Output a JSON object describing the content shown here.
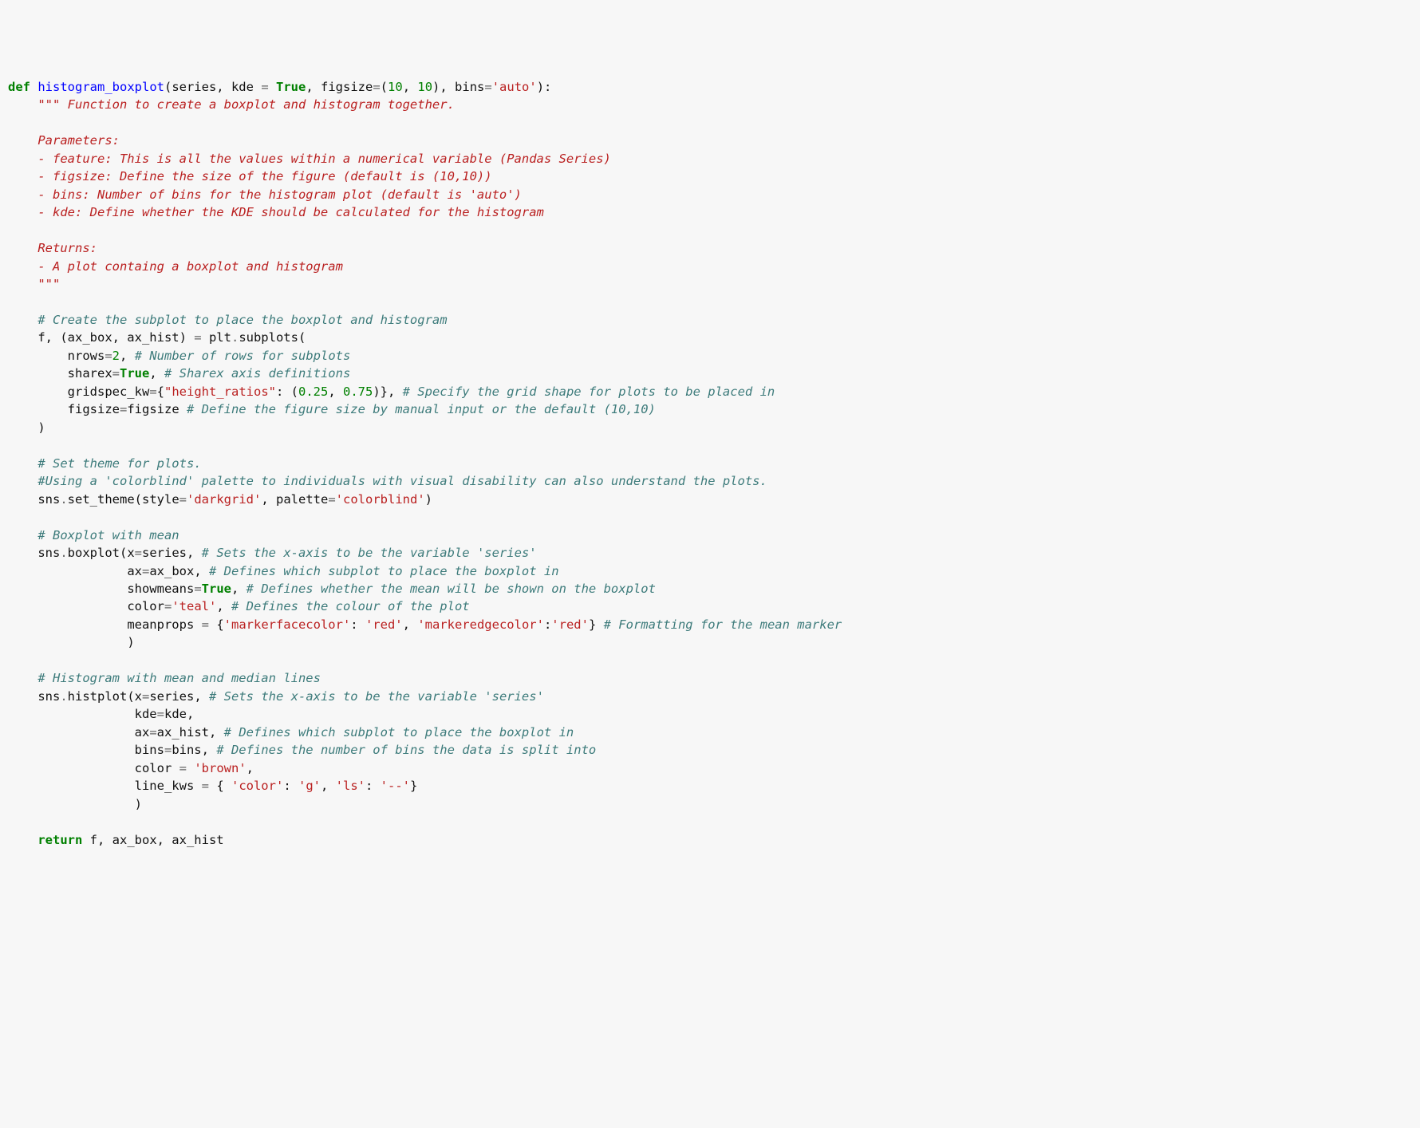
{
  "code": {
    "l1": {
      "kw1": "def",
      "fn": "histogram_boxplot",
      "s1": "(series, kde ",
      "eq1": "=",
      "sp1": " ",
      "true1": "True",
      "s2": ", figsize",
      "eq2": "=",
      "s3": "(",
      "n1": "10",
      "s4": ", ",
      "n2": "10",
      "s5": "), bins",
      "eq3": "=",
      "str1": "'auto'",
      "s6": "):"
    },
    "doc": "\"\"\" Function to create a boxplot and histogram together.\n\n    Parameters:\n    - feature: This is all the values within a numerical variable (Pandas Series)\n    - figsize: Define the size of the figure (default is (10,10))\n    - bins: Number of bins for the histogram plot (default is 'auto')\n    - kde: Define whether the KDE should be calculated for the histogram\n\n    Returns:\n    - A plot containg a boxplot and histogram\n    \"\"\"",
    "c_sub": "# Create the subplot to place the boxplot and histogram",
    "l_sub1": {
      "a": "f, (ax_box, ax_hist) ",
      "eq": "=",
      "b": " plt",
      "dot": ".",
      "c": "subplots("
    },
    "l_nrows": {
      "a": "nrows",
      "eq": "=",
      "n": "2",
      "b": ", ",
      "c": "# Number of rows for subplots"
    },
    "l_sharex": {
      "a": "sharex",
      "eq": "=",
      "b": "True",
      "c": ", ",
      "d": "# Sharex axis definitions"
    },
    "l_grid": {
      "a": "gridspec_kw",
      "eq": "=",
      "b": "{",
      "s1": "\"height_ratios\"",
      "c": ": (",
      "n1": "0.25",
      "d": ", ",
      "n2": "0.75",
      "e": ")}, ",
      "f": "# Specify the grid shape for plots to be placed in"
    },
    "l_fig": {
      "a": "figsize",
      "eq": "=",
      "b": "figsize ",
      "c": "# Define the figure size by manual input or the default (10,10)"
    },
    "close_paren": ")",
    "c_theme1": "# Set theme for plots.",
    "c_theme2": "#Using a 'colorblind' palette to individuals with visual disability can also understand the plots.",
    "l_theme": {
      "a": "sns",
      "dot": ".",
      "b": "set_theme(style",
      "eq1": "=",
      "s1": "'darkgrid'",
      "c": ", palette",
      "eq2": "=",
      "s2": "'colorblind'",
      "d": ")"
    },
    "c_box": "# Boxplot with mean",
    "l_box1": {
      "a": "sns",
      "dot": ".",
      "b": "boxplot(x",
      "eq": "=",
      "c": "series, ",
      "d": "# Sets the x-axis to be the variable 'series'"
    },
    "l_box2": {
      "a": "ax",
      "eq": "=",
      "b": "ax_box, ",
      "c": "# Defines which subplot to place the boxplot in"
    },
    "l_box3": {
      "a": "showmeans",
      "eq": "=",
      "b": "True",
      "c": ", ",
      "d": "# Defines whether the mean will be shown on the boxplot"
    },
    "l_box4": {
      "a": "color",
      "eq": "=",
      "s": "'teal'",
      "b": ", ",
      "c": "# Defines the colour of the plot"
    },
    "l_box5": {
      "a": "meanprops ",
      "eq": "=",
      "b": " {",
      "s1": "'markerfacecolor'",
      "c": ": ",
      "s2": "'red'",
      "d": ", ",
      "s3": "'markeredgecolor'",
      "e": ":",
      "s4": "'red'",
      "f": "} ",
      "g": "# Formatting for the mean marker"
    },
    "l_box6": ")",
    "c_hist": "# Histogram with mean and median lines",
    "l_hist1": {
      "a": "sns",
      "dot": ".",
      "b": "histplot(x",
      "eq": "=",
      "c": "series, ",
      "d": "# Sets the x-axis to be the variable 'series'"
    },
    "l_hist2": {
      "a": "kde",
      "eq": "=",
      "b": "kde,"
    },
    "l_hist3": {
      "a": "ax",
      "eq": "=",
      "b": "ax_hist, ",
      "c": "# Defines which subplot to place the boxplot in"
    },
    "l_hist4": {
      "a": "bins",
      "eq": "=",
      "b": "bins, ",
      "c": "# Defines the number of bins the data is split into"
    },
    "l_hist5": {
      "a": "color ",
      "eq": "=",
      "b": " ",
      "s": "'brown'",
      "c": ","
    },
    "l_hist6": {
      "a": "line_kws ",
      "eq": "=",
      "b": " { ",
      "s1": "'color'",
      "c": ": ",
      "s2": "'g'",
      "d": ", ",
      "s3": "'ls'",
      "e": ": ",
      "s4": "'--'",
      "f": "}"
    },
    "l_hist7": ")",
    "ret": {
      "kw": "return",
      "a": " f, ax_box, ax_hist"
    }
  }
}
